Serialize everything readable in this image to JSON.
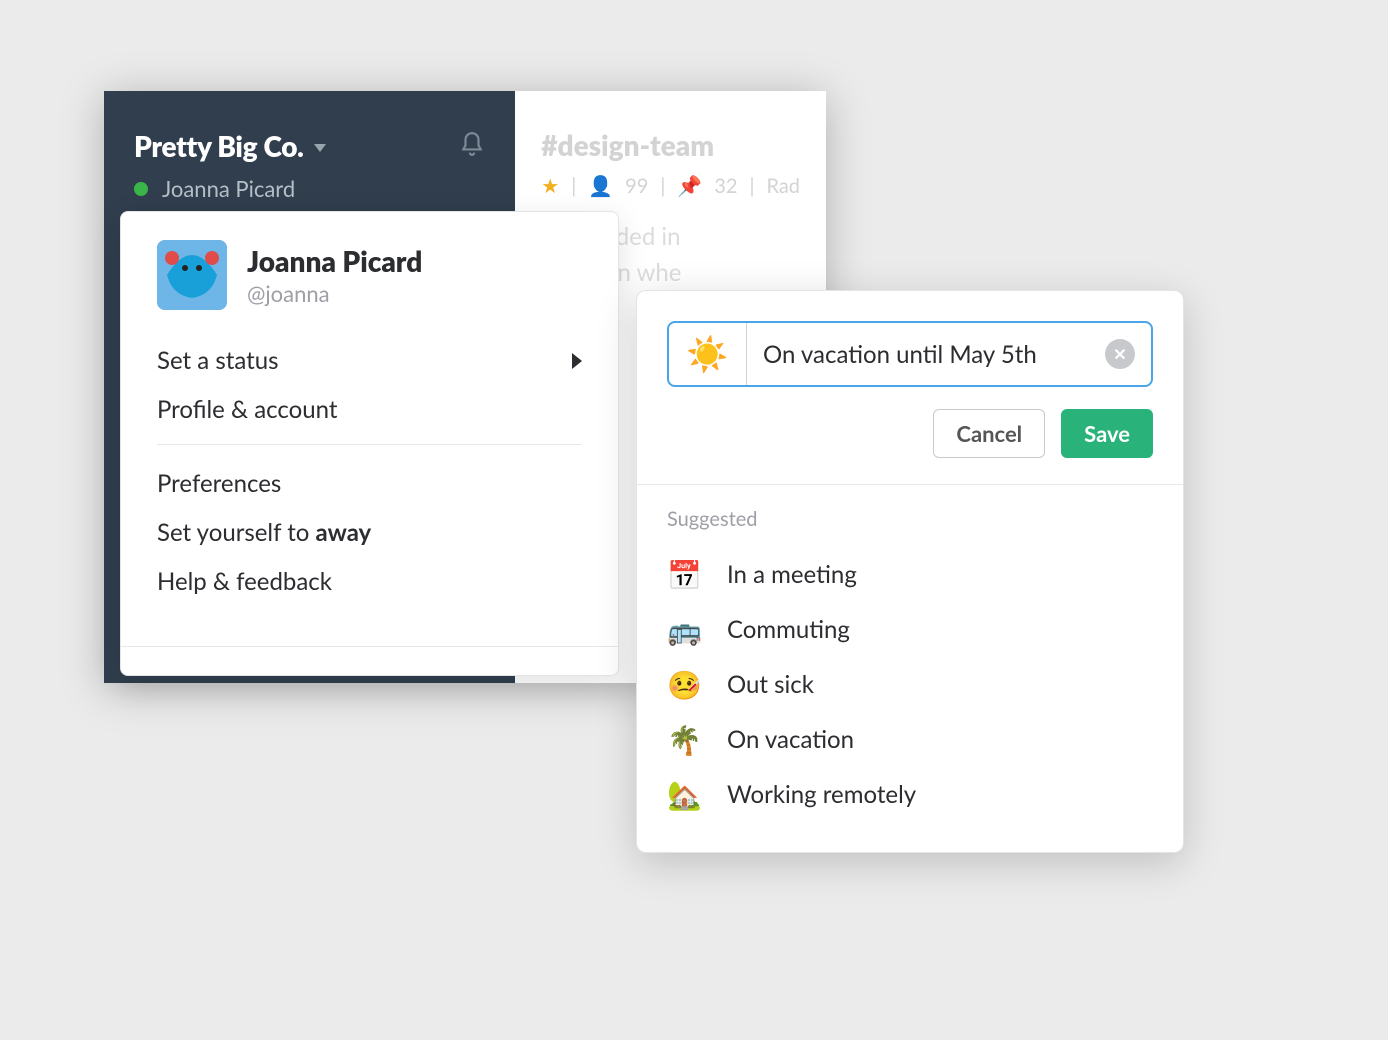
{
  "workspace": {
    "name": "Pretty Big Co.",
    "user": "Joanna Picard"
  },
  "channel": {
    "name": "#design-team",
    "members": "99",
    "pins": "32",
    "topic_partial": "Rad",
    "body_line1": "was folded in",
    "body_line2": "but then whe"
  },
  "account_menu": {
    "user_name": "Joanna Picard",
    "user_handle": "@joanna",
    "items": {
      "set_status": "Set a status",
      "profile": "Profile & account",
      "preferences": "Preferences",
      "set_away_prefix": "Set yourself to ",
      "set_away_bold": "away",
      "help": "Help & feedback"
    }
  },
  "status_popover": {
    "emoji": "☀️",
    "input_value": "On vacation until May 5th",
    "cancel": "Cancel",
    "save": "Save",
    "suggested_label": "Suggested",
    "suggestions": [
      {
        "emoji": "📅",
        "label": "In a meeting"
      },
      {
        "emoji": "🚌",
        "label": "Commuting"
      },
      {
        "emoji": "🤒",
        "label": "Out sick"
      },
      {
        "emoji": "🌴",
        "label": "On vacation"
      },
      {
        "emoji": "🏡",
        "label": "Working remotely"
      }
    ]
  }
}
